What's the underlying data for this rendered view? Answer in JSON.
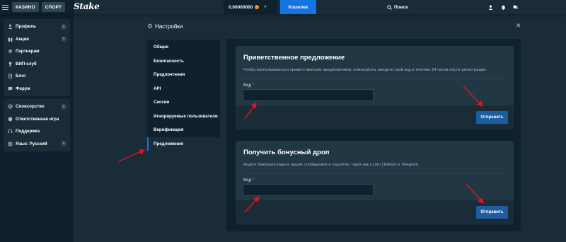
{
  "sidebar": {
    "tabs": [
      {
        "label": "КАЗИНО"
      },
      {
        "label": "СПОРТ"
      }
    ],
    "group1": [
      {
        "label": "Профиль",
        "icon": "user-icon",
        "has_chevron": true
      },
      {
        "label": "Акции",
        "icon": "gift-icon",
        "has_chevron": true
      },
      {
        "label": "Партнерам",
        "icon": "affiliate-icon",
        "has_chevron": false
      },
      {
        "label": "ВИП-клуб",
        "icon": "trophy-icon",
        "has_chevron": false
      },
      {
        "label": "Блог",
        "icon": "document-icon",
        "has_chevron": false
      },
      {
        "label": "Форум",
        "icon": "chat-icon",
        "has_chevron": false
      }
    ],
    "group2": [
      {
        "label": "Спонсорство",
        "icon": "sponsor-icon",
        "has_chevron": true
      },
      {
        "label": "Ответственная игра",
        "icon": "shield-icon",
        "has_chevron": false
      },
      {
        "label": "Поддержка",
        "icon": "headset-icon",
        "has_chevron": false
      },
      {
        "label": "Язык: Русский",
        "icon": "globe-icon",
        "has_chevron": true
      }
    ]
  },
  "header": {
    "logo": "Stake",
    "balance": "0.00000000",
    "wallet_label": "Кошелек",
    "search_label": "Поиск"
  },
  "settings": {
    "title": "Настройки",
    "nav": [
      {
        "label": "Общие"
      },
      {
        "label": "Безопасность"
      },
      {
        "label": "Предпочтения"
      },
      {
        "label": "API"
      },
      {
        "label": "Сессии"
      },
      {
        "label": "Игнорируемые пользователи"
      },
      {
        "label": "Верификация"
      },
      {
        "label": "Предложения",
        "active": true
      }
    ]
  },
  "offer_card": {
    "title": "Приветственное предложение",
    "description": "Чтобы воспользоваться приветственным предложением, пожалуйста, введите свой код в течение 24 часов после регистрации.",
    "code_label": "Код",
    "required_mark": "*",
    "code_value": "",
    "send_label": "Отправить"
  },
  "drop_card": {
    "title": "Получить бонусный дроп",
    "description": "Ищите бонусные коды в наших сообщениях в соцсетях, таких как x.com (Twitter) и Telegram.",
    "code_label": "Код",
    "required_mark": "*",
    "code_value": "",
    "send_label": "Отправить"
  },
  "colors": {
    "background": "#1a2c38",
    "sidebar": "#0f212e",
    "card": "#213743",
    "accent_blue": "#1475e1",
    "button_blue": "#1d5da0",
    "annotation_arrow": "#e0141e",
    "required": "#ed4163"
  }
}
